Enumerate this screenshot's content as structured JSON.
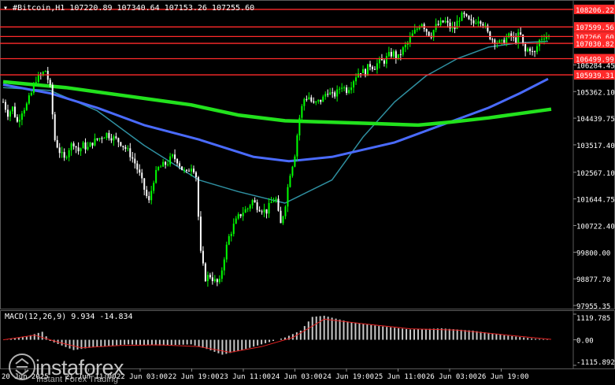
{
  "header": {
    "symbol": "#Bitcoin,H1",
    "ohlc": "107220.89 107340.64 107153.26 107255.60"
  },
  "macd": {
    "label": "MACD(12,26,9) 9.934 -14.834",
    "axis_labels": [
      "1119.785",
      "0.00",
      "-1115.892"
    ]
  },
  "watermark": {
    "brand": "instaforex",
    "sub": "Instant Forex Trading"
  },
  "colors": {
    "background": "#000000",
    "candle_up": "#00ff00",
    "candle_down": "#ffffff",
    "ma_fast": "#2f8fa0",
    "ma_mid": "#4a6bff",
    "ma_slow": "#22e21d",
    "levels": "#ff2a2a",
    "macd_hist": "#c8c8c8",
    "macd_signal": "#e02020"
  },
  "chart_data": {
    "type": "candlestick",
    "y_axis_labels": [
      "106284.45",
      "105362.10",
      "104439.75",
      "103517.40",
      "102567.10",
      "101644.75",
      "100722.40",
      "99800.00",
      "98877.70",
      "97955.35"
    ],
    "ylim": [
      97955.35,
      108640
    ],
    "x_tick_labels": [
      "20 Jun 2025",
      "21 Jun 11:00",
      "22 Jun 03:00",
      "22 Jun 19:00",
      "23 Jun 11:00",
      "24 Jun 03:00",
      "24 Jun 19:00",
      "25 Jun 11:00",
      "26 Jun 03:00",
      "26 Jun 19:00"
    ],
    "levels": [
      {
        "label": "108206.22",
        "value": 108206.22
      },
      {
        "label": "107599.56",
        "value": 107599.56
      },
      {
        "label": "107266.60",
        "value": 107266.6
      },
      {
        "label": "107030.82",
        "value": 107030.82
      },
      {
        "label": "106499.99",
        "value": 106499.99
      },
      {
        "label": "105939.31",
        "value": 105939.31
      }
    ],
    "price_path": [
      [
        0,
        105000
      ],
      [
        6,
        104600
      ],
      [
        12,
        104800
      ],
      [
        18,
        104300
      ],
      [
        24,
        104700
      ],
      [
        30,
        104900
      ],
      [
        36,
        105300
      ],
      [
        42,
        105800
      ],
      [
        48,
        105900
      ],
      [
        54,
        106100
      ],
      [
        60,
        105500
      ],
      [
        66,
        103700
      ],
      [
        72,
        103300
      ],
      [
        78,
        103000
      ],
      [
        84,
        103400
      ],
      [
        90,
        103600
      ],
      [
        96,
        103300
      ],
      [
        102,
        103500
      ],
      [
        108,
        103400
      ],
      [
        114,
        103600
      ],
      [
        120,
        103700
      ],
      [
        126,
        103800
      ],
      [
        132,
        103900
      ],
      [
        138,
        103800
      ],
      [
        144,
        103700
      ],
      [
        150,
        103600
      ],
      [
        156,
        103400
      ],
      [
        162,
        103200
      ],
      [
        168,
        102900
      ],
      [
        174,
        102500
      ],
      [
        180,
        102000
      ],
      [
        186,
        101500
      ],
      [
        192,
        102300
      ],
      [
        198,
        102700
      ],
      [
        204,
        102800
      ],
      [
        210,
        102900
      ],
      [
        216,
        103100
      ],
      [
        222,
        103000
      ],
      [
        228,
        102700
      ],
      [
        234,
        102500
      ],
      [
        240,
        102800
      ],
      [
        246,
        102600
      ],
      [
        252,
        99800
      ],
      [
        258,
        98900
      ],
      [
        264,
        99000
      ],
      [
        270,
        98800
      ],
      [
        276,
        98700
      ],
      [
        282,
        99600
      ],
      [
        288,
        100300
      ],
      [
        294,
        100700
      ],
      [
        300,
        101000
      ],
      [
        306,
        101200
      ],
      [
        312,
        101300
      ],
      [
        318,
        101600
      ],
      [
        324,
        101400
      ],
      [
        330,
        101300
      ],
      [
        336,
        101200
      ],
      [
        342,
        101500
      ],
      [
        348,
        101700
      ],
      [
        354,
        100700
      ],
      [
        360,
        101400
      ],
      [
        366,
        102500
      ],
      [
        372,
        103100
      ],
      [
        378,
        104400
      ],
      [
        384,
        105100
      ],
      [
        390,
        105200
      ],
      [
        396,
        104900
      ],
      [
        402,
        105000
      ],
      [
        408,
        105100
      ],
      [
        414,
        105400
      ],
      [
        420,
        105200
      ],
      [
        426,
        105300
      ],
      [
        432,
        105600
      ],
      [
        438,
        105400
      ],
      [
        444,
        105600
      ],
      [
        450,
        105900
      ],
      [
        456,
        106100
      ],
      [
        462,
        106000
      ],
      [
        468,
        106300
      ],
      [
        474,
        106200
      ],
      [
        480,
        106400
      ],
      [
        486,
        106400
      ],
      [
        492,
        106600
      ],
      [
        498,
        106700
      ],
      [
        504,
        106500
      ],
      [
        510,
        106800
      ],
      [
        516,
        107000
      ],
      [
        522,
        107300
      ],
      [
        528,
        107500
      ],
      [
        534,
        107800
      ],
      [
        540,
        107500
      ],
      [
        546,
        107300
      ],
      [
        552,
        107600
      ],
      [
        558,
        107700
      ],
      [
        564,
        107800
      ],
      [
        570,
        107600
      ],
      [
        576,
        107500
      ],
      [
        582,
        107900
      ],
      [
        588,
        108000
      ],
      [
        594,
        107800
      ],
      [
        600,
        107700
      ],
      [
        606,
        107900
      ],
      [
        612,
        107800
      ],
      [
        618,
        107400
      ],
      [
        624,
        107200
      ],
      [
        630,
        107100
      ],
      [
        636,
        107000
      ],
      [
        642,
        107200
      ],
      [
        648,
        107300
      ],
      [
        654,
        107100
      ],
      [
        660,
        107400
      ],
      [
        666,
        106700
      ],
      [
        672,
        106900
      ],
      [
        678,
        106600
      ],
      [
        684,
        107100
      ],
      [
        690,
        107300
      ],
      [
        696,
        107260
      ]
    ],
    "ma_fast": [
      [
        0,
        105500
      ],
      [
        60,
        105400
      ],
      [
        120,
        104700
      ],
      [
        180,
        103500
      ],
      [
        250,
        102300
      ],
      [
        300,
        101900
      ],
      [
        360,
        101500
      ],
      [
        420,
        102300
      ],
      [
        460,
        103800
      ],
      [
        500,
        105000
      ],
      [
        540,
        105900
      ],
      [
        580,
        106500
      ],
      [
        620,
        106900
      ],
      [
        660,
        107050
      ],
      [
        696,
        107100
      ]
    ],
    "ma_mid": [
      [
        0,
        105600
      ],
      [
        60,
        105300
      ],
      [
        120,
        104800
      ],
      [
        180,
        104200
      ],
      [
        250,
        103700
      ],
      [
        320,
        103100
      ],
      [
        365,
        102950
      ],
      [
        420,
        103100
      ],
      [
        500,
        103600
      ],
      [
        560,
        104200
      ],
      [
        620,
        104800
      ],
      [
        660,
        105300
      ],
      [
        696,
        105800
      ]
    ],
    "ma_slow": [
      [
        0,
        105700
      ],
      [
        80,
        105500
      ],
      [
        160,
        105200
      ],
      [
        240,
        104900
      ],
      [
        300,
        104550
      ],
      [
        360,
        104350
      ],
      [
        420,
        104300
      ],
      [
        480,
        104250
      ],
      [
        530,
        104200
      ],
      [
        570,
        104300
      ],
      [
        620,
        104450
      ],
      [
        660,
        104600
      ],
      [
        700,
        104750
      ]
    ],
    "macd_axis_values": [
      1119.785,
      0.0,
      -1115.892
    ],
    "macd_path": [
      [
        0,
        0
      ],
      [
        30,
        150
      ],
      [
        50,
        350
      ],
      [
        60,
        -50
      ],
      [
        90,
        -450
      ],
      [
        120,
        -300
      ],
      [
        160,
        -200
      ],
      [
        200,
        -250
      ],
      [
        240,
        -200
      ],
      [
        260,
        -400
      ],
      [
        280,
        -650
      ],
      [
        300,
        -500
      ],
      [
        330,
        -200
      ],
      [
        360,
        100
      ],
      [
        380,
        400
      ],
      [
        395,
        1000
      ],
      [
        410,
        1050
      ],
      [
        440,
        800
      ],
      [
        480,
        600
      ],
      [
        520,
        450
      ],
      [
        560,
        500
      ],
      [
        600,
        400
      ],
      [
        640,
        200
      ],
      [
        680,
        40
      ],
      [
        700,
        10
      ]
    ],
    "signal_path": [
      [
        0,
        0
      ],
      [
        40,
        200
      ],
      [
        70,
        -100
      ],
      [
        100,
        -350
      ],
      [
        150,
        -250
      ],
      [
        200,
        -220
      ],
      [
        250,
        -300
      ],
      [
        290,
        -550
      ],
      [
        330,
        -300
      ],
      [
        370,
        100
      ],
      [
        410,
        900
      ],
      [
        460,
        700
      ],
      [
        520,
        480
      ],
      [
        580,
        420
      ],
      [
        640,
        220
      ],
      [
        690,
        50
      ],
      [
        700,
        20
      ]
    ]
  }
}
